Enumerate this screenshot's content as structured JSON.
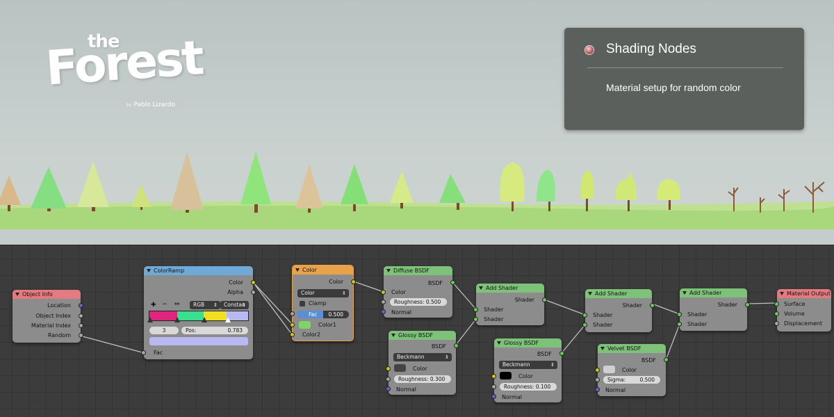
{
  "logo": {
    "the": "the",
    "forest": "Forest",
    "by": "by",
    "author": "Pablo Lizardo"
  },
  "info_panel": {
    "title": "Shading Nodes",
    "description": "Material setup for random color"
  },
  "nodes": {
    "object_info": {
      "title": "Object Info",
      "outputs": [
        "Location",
        "Object Index",
        "Material Index",
        "Random"
      ]
    },
    "color_ramp": {
      "title": "ColorRamp",
      "outputs": [
        "Color",
        "Alpha"
      ],
      "mode": "RGB",
      "interpolation": "Constan",
      "stop_index": "3",
      "pos_label": "Pos:",
      "pos_value": "0.783",
      "input": "Fac",
      "stops": [
        "#e0257f",
        "#3be08f",
        "#f2e020",
        "#b7b9f0"
      ],
      "selected_color": "#b7b9f0"
    },
    "mix_color": {
      "title": "Color",
      "output": "Color",
      "blend": "Color",
      "clamp": "Clamp",
      "fac_label": "Fac",
      "fac_value": "0.500",
      "fac_fraction": 0.5,
      "inputs": [
        "Color1",
        "Color2"
      ],
      "color1": "#7fd36b"
    },
    "diffuse": {
      "title": "Diffuse BSDF",
      "output": "BSDF",
      "color": "Color",
      "roughness_label": "Roughness:",
      "roughness": "0.500",
      "normal": "Normal"
    },
    "glossy1": {
      "title": "Glossy BSDF",
      "output": "BSDF",
      "distribution": "Beckmann",
      "color": "Color",
      "roughness_label": "Roughness:",
      "roughness": "0.300",
      "normal": "Normal",
      "swatch": "#444444"
    },
    "add_shader1": {
      "title": "Add Shader",
      "output": "Shader",
      "inputs": [
        "Shader",
        "Shader"
      ]
    },
    "glossy2": {
      "title": "Glossy BSDF",
      "output": "BSDF",
      "distribution": "Beckmann",
      "color": "Color",
      "roughness_label": "Roughness:",
      "roughness": "0.100",
      "normal": "Normal",
      "swatch": "#000000"
    },
    "add_shader2": {
      "title": "Add Shader",
      "output": "Shader",
      "inputs": [
        "Shader",
        "Shader"
      ]
    },
    "velvet": {
      "title": "Velvet BSDF",
      "output": "BSDF",
      "color": "Color",
      "sigma_label": "Sigma:",
      "sigma": "0.500",
      "normal": "Normal",
      "swatch": "#d0d0d0"
    },
    "add_shader3": {
      "title": "Add Shader",
      "output": "Shader",
      "inputs": [
        "Shader",
        "Shader"
      ]
    },
    "material_output": {
      "title": "Material Output",
      "inputs": [
        "Surface",
        "Volume",
        "Displacement"
      ]
    }
  }
}
